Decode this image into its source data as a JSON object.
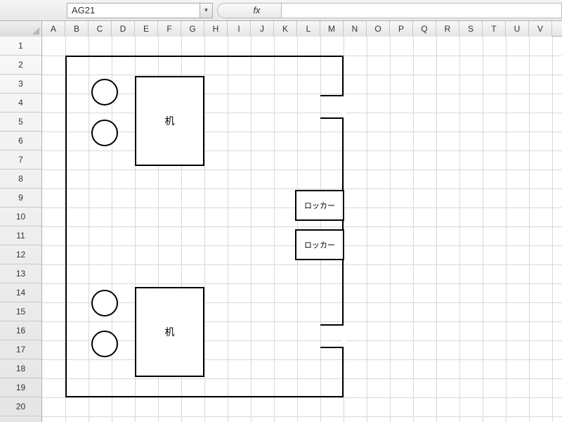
{
  "formula_bar": {
    "cell_ref": "AG21",
    "fx_label": "fx",
    "formula_value": ""
  },
  "columns": [
    "A",
    "B",
    "C",
    "D",
    "E",
    "F",
    "G",
    "H",
    "I",
    "J",
    "K",
    "L",
    "M",
    "N",
    "O",
    "P",
    "Q",
    "R",
    "S",
    "T",
    "U",
    "V"
  ],
  "rows": [
    "1",
    "2",
    "3",
    "4",
    "5",
    "6",
    "7",
    "8",
    "9",
    "10",
    "11",
    "12",
    "13",
    "14",
    "15",
    "16",
    "17",
    "18",
    "19",
    "20"
  ],
  "shapes": {
    "desk1_label": "机",
    "desk2_label": "机",
    "locker1_label": "ロッカー",
    "locker2_label": "ロッカー"
  },
  "icons": {
    "dropdown": "▼"
  }
}
